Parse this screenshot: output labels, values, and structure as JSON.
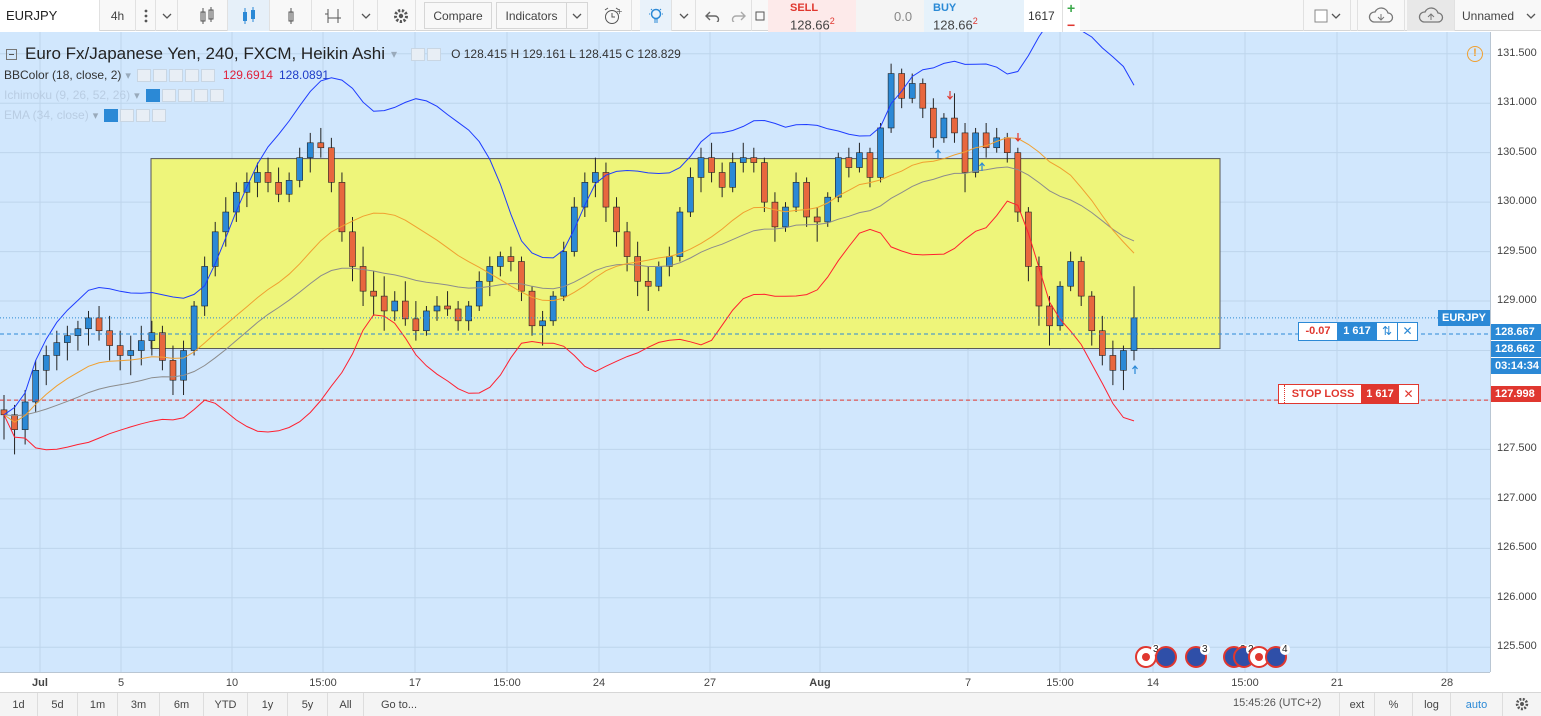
{
  "toolbar": {
    "symbol": "EURJPY",
    "interval": "4h",
    "compare_label": "Compare",
    "indicators_label": "Indicators",
    "layout_name": "Unnamed"
  },
  "trade": {
    "sell_label": "SELL",
    "sell_price": "128.66",
    "sell_pip": "2",
    "spread": "0.0",
    "buy_label": "BUY",
    "buy_price": "128.66",
    "buy_pip": "2",
    "quantity": "1617",
    "plus": "+",
    "minus": "−"
  },
  "legend": {
    "title": "Euro Fx/Japanese Yen, 240, FXCM, Heikin Ashi",
    "ohlc": "O 128.415 H 129.161 L 128.415 C 128.829",
    "bb_name": "BBColor (18, close, 2)",
    "bb_upper": "129.6914",
    "bb_lower": "128.0891",
    "ichimoku_name": "Ichimoku (9, 26, 52, 26)",
    "ema_name": "EMA (34, close)"
  },
  "price_scale": {
    "ticks": [
      "131.500",
      "131.000",
      "130.500",
      "130.000",
      "129.500",
      "129.000",
      "128.500",
      "128.000",
      "127.500",
      "127.000",
      "126.500",
      "126.000",
      "125.500"
    ],
    "symbol_badge": "EURJPY",
    "buy_badge": "128.667",
    "sell_badge": "128.662",
    "countdown_badge": "03:14:34",
    "stop_badge": "127.998"
  },
  "time_axis": {
    "ticks": [
      "Jul",
      "5",
      "10",
      "15:00",
      "17",
      "15:00",
      "24",
      "27",
      "Aug",
      "7",
      "15:00",
      "14",
      "15:00",
      "21",
      "28",
      "24"
    ]
  },
  "position": {
    "pnl": "-0.07",
    "qty": "1 617",
    "reverse_icon": "⇅",
    "close_icon": "✕"
  },
  "stop_loss": {
    "label": "STOP LOSS",
    "qty": "1 617",
    "close_icon": "✕"
  },
  "events": {
    "e1": "3",
    "e2": "3",
    "e3": "2",
    "e4": "2",
    "e5": "4"
  },
  "bottom": {
    "ranges": [
      "1d",
      "5d",
      "1m",
      "3m",
      "6m",
      "YTD",
      "1y",
      "5y",
      "All"
    ],
    "goto": "Go to...",
    "time": "15:45:26 (UTC+2)",
    "ext": "ext",
    "percent": "%",
    "log": "log",
    "auto": "auto"
  },
  "colors": {
    "chart_bg": "#d1e7fd",
    "up_candle": "#2b89d6",
    "down_candle": "#e8673e",
    "zone_fill": "#eef57a",
    "bb_upper": "#1e3cff",
    "bb_lower": "#ff2030",
    "bb_basis": "#f0a030",
    "ema": "#8c8c8c"
  },
  "chart_data": {
    "type": "candlestick",
    "y_range": [
      125.25,
      131.72
    ],
    "zone": {
      "top": 130.44,
      "bottom": 128.52
    },
    "position_line": 128.667,
    "current_price": 128.83,
    "stop_loss_level": 127.998,
    "candles": [
      [
        127.9,
        128.05,
        127.6,
        127.85
      ],
      [
        127.85,
        127.95,
        127.45,
        127.7
      ],
      [
        127.7,
        128.1,
        127.55,
        127.98
      ],
      [
        127.98,
        128.4,
        127.88,
        128.3
      ],
      [
        128.3,
        128.55,
        128.15,
        128.45
      ],
      [
        128.45,
        128.7,
        128.3,
        128.58
      ],
      [
        128.58,
        128.75,
        128.4,
        128.65
      ],
      [
        128.65,
        128.8,
        128.5,
        128.72
      ],
      [
        128.72,
        128.9,
        128.55,
        128.83
      ],
      [
        128.83,
        128.95,
        128.6,
        128.7
      ],
      [
        128.7,
        128.85,
        128.4,
        128.55
      ],
      [
        128.55,
        128.7,
        128.3,
        128.45
      ],
      [
        128.45,
        128.65,
        128.25,
        128.5
      ],
      [
        128.5,
        128.75,
        128.35,
        128.6
      ],
      [
        128.6,
        128.8,
        128.45,
        128.68
      ],
      [
        128.68,
        128.75,
        128.3,
        128.4
      ],
      [
        128.4,
        128.55,
        128.05,
        128.2
      ],
      [
        128.2,
        128.6,
        128.05,
        128.5
      ],
      [
        128.5,
        129.0,
        128.45,
        128.95
      ],
      [
        128.95,
        129.45,
        128.85,
        129.35
      ],
      [
        129.35,
        129.8,
        129.25,
        129.7
      ],
      [
        129.7,
        130.05,
        129.55,
        129.9
      ],
      [
        129.9,
        130.2,
        129.8,
        130.1
      ],
      [
        130.1,
        130.3,
        129.95,
        130.2
      ],
      [
        130.2,
        130.4,
        130.05,
        130.3
      ],
      [
        130.3,
        130.45,
        130.1,
        130.2
      ],
      [
        130.2,
        130.35,
        130.0,
        130.08
      ],
      [
        130.08,
        130.3,
        130.0,
        130.22
      ],
      [
        130.22,
        130.55,
        130.15,
        130.45
      ],
      [
        130.45,
        130.7,
        130.3,
        130.6
      ],
      [
        130.6,
        130.75,
        130.45,
        130.55
      ],
      [
        130.55,
        130.65,
        130.1,
        130.2
      ],
      [
        130.2,
        130.3,
        129.6,
        129.7
      ],
      [
        129.7,
        129.85,
        129.2,
        129.35
      ],
      [
        129.35,
        129.55,
        128.95,
        129.1
      ],
      [
        129.1,
        129.3,
        128.85,
        129.05
      ],
      [
        129.05,
        129.25,
        128.7,
        128.9
      ],
      [
        128.9,
        129.1,
        128.8,
        129.0
      ],
      [
        129.0,
        129.2,
        128.75,
        128.82
      ],
      [
        128.82,
        129.0,
        128.6,
        128.7
      ],
      [
        128.7,
        128.95,
        128.65,
        128.9
      ],
      [
        128.9,
        129.05,
        128.8,
        128.95
      ],
      [
        128.95,
        129.1,
        128.85,
        128.92
      ],
      [
        128.92,
        129.0,
        128.7,
        128.8
      ],
      [
        128.8,
        129.0,
        128.7,
        128.95
      ],
      [
        128.95,
        129.3,
        128.9,
        129.2
      ],
      [
        129.2,
        129.45,
        129.05,
        129.35
      ],
      [
        129.35,
        129.5,
        129.25,
        129.45
      ],
      [
        129.45,
        129.55,
        129.3,
        129.4
      ],
      [
        129.4,
        129.45,
        129.0,
        129.1
      ],
      [
        129.1,
        129.15,
        128.65,
        128.75
      ],
      [
        128.75,
        128.9,
        128.55,
        128.8
      ],
      [
        128.8,
        129.1,
        128.75,
        129.05
      ],
      [
        129.05,
        129.6,
        129.0,
        129.5
      ],
      [
        129.5,
        130.05,
        129.45,
        129.95
      ],
      [
        129.95,
        130.3,
        129.85,
        130.2
      ],
      [
        130.2,
        130.45,
        130.05,
        130.3
      ],
      [
        130.3,
        130.4,
        129.8,
        129.95
      ],
      [
        129.95,
        130.05,
        129.55,
        129.7
      ],
      [
        129.7,
        129.8,
        129.3,
        129.45
      ],
      [
        129.45,
        129.6,
        129.05,
        129.2
      ],
      [
        129.2,
        129.35,
        128.9,
        129.15
      ],
      [
        129.15,
        129.4,
        129.1,
        129.35
      ],
      [
        129.35,
        129.55,
        129.25,
        129.45
      ],
      [
        129.45,
        129.95,
        129.4,
        129.9
      ],
      [
        129.9,
        130.35,
        129.85,
        130.25
      ],
      [
        130.25,
        130.55,
        130.1,
        130.45
      ],
      [
        130.45,
        130.6,
        130.2,
        130.3
      ],
      [
        130.3,
        130.4,
        130.05,
        130.15
      ],
      [
        130.15,
        130.5,
        130.1,
        130.4
      ],
      [
        130.4,
        130.6,
        130.3,
        130.45
      ],
      [
        130.45,
        130.55,
        130.3,
        130.4
      ],
      [
        130.4,
        130.45,
        129.9,
        130.0
      ],
      [
        130.0,
        130.1,
        129.6,
        129.75
      ],
      [
        129.75,
        130.0,
        129.7,
        129.95
      ],
      [
        129.95,
        130.3,
        129.9,
        130.2
      ],
      [
        130.2,
        130.25,
        129.75,
        129.85
      ],
      [
        129.85,
        129.95,
        129.6,
        129.8
      ],
      [
        129.8,
        130.1,
        129.75,
        130.05
      ],
      [
        130.05,
        130.5,
        130.0,
        130.45
      ],
      [
        130.45,
        130.55,
        130.25,
        130.35
      ],
      [
        130.35,
        130.6,
        130.3,
        130.5
      ],
      [
        130.5,
        130.55,
        130.15,
        130.25
      ],
      [
        130.25,
        130.8,
        130.2,
        130.75
      ],
      [
        130.75,
        131.4,
        130.7,
        131.3
      ],
      [
        131.3,
        131.35,
        130.95,
        131.05
      ],
      [
        131.05,
        131.3,
        131.0,
        131.2
      ],
      [
        131.2,
        131.25,
        130.85,
        130.95
      ],
      [
        130.95,
        131.05,
        130.55,
        130.65
      ],
      [
        130.65,
        130.9,
        130.6,
        130.85
      ],
      [
        130.85,
        131.1,
        130.6,
        130.7
      ],
      [
        130.7,
        130.8,
        130.1,
        130.3
      ],
      [
        130.3,
        130.75,
        130.25,
        130.7
      ],
      [
        130.7,
        130.8,
        130.45,
        130.55
      ],
      [
        130.55,
        130.75,
        130.5,
        130.65
      ],
      [
        130.65,
        130.7,
        130.4,
        130.5
      ],
      [
        130.5,
        130.55,
        129.8,
        129.9
      ],
      [
        129.9,
        129.95,
        129.2,
        129.35
      ],
      [
        129.35,
        129.45,
        128.75,
        128.95
      ],
      [
        128.95,
        129.05,
        128.55,
        128.75
      ],
      [
        128.75,
        129.2,
        128.7,
        129.15
      ],
      [
        129.15,
        129.5,
        129.1,
        129.4
      ],
      [
        129.4,
        129.45,
        128.95,
        129.05
      ],
      [
        129.05,
        129.1,
        128.55,
        128.7
      ],
      [
        128.7,
        128.85,
        128.35,
        128.45
      ],
      [
        128.45,
        128.6,
        128.15,
        128.3
      ],
      [
        128.3,
        128.55,
        128.1,
        128.5
      ],
      [
        128.5,
        129.15,
        128.4,
        128.83
      ]
    ]
  }
}
